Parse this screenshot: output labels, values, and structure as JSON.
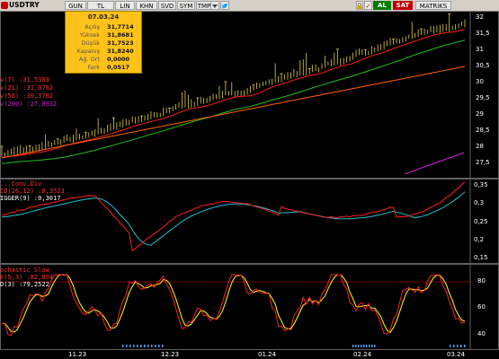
{
  "toolbar": {
    "symbol": "USDTRY",
    "buttons": [
      "GUN",
      "TL",
      "LIN",
      "KHN",
      "SVD",
      "SYM",
      "TMP"
    ],
    "buy_label": "AL",
    "sell_label": "SAT",
    "matrix_label": "MATRiKS"
  },
  "tooltip": {
    "date": "07.03.24",
    "rows": [
      {
        "label": "Açılış",
        "value": "31,7714"
      },
      {
        "label": "Yüksek",
        "value": "31,8681"
      },
      {
        "label": "Düşük",
        "value": "31,7523"
      },
      {
        "label": "Kapanış",
        "value": "31,8240"
      },
      {
        "label": "Ağ. Ort",
        "value": "0,0000"
      },
      {
        "label": "Fark",
        "value": "0,0517"
      }
    ]
  },
  "price_panel": {
    "legend": [
      {
        "text": "v(7)     :31,5303",
        "color": "#ff3030"
      },
      {
        "text": "v(21)    :31,0762",
        "color": "#ff3030"
      },
      {
        "text": "v(56)    :30,3782",
        "color": "#ff3030"
      },
      {
        "text": "v(200)   :27,8932",
        "color": "#d020d0"
      }
    ],
    "y_ticks": [
      "32",
      "31,5",
      "31",
      "30,5",
      "30",
      "29,5",
      "29",
      "28,5",
      "28",
      "27,5"
    ]
  },
  "macd_panel": {
    "legend": [
      {
        "text": "...Conv.Div",
        "color": "#ff3030"
      },
      {
        "text": "CD(26,12)  :0,3523",
        "color": "#ff3030"
      },
      {
        "text": "IGGER(9)   :0,3017",
        "color": "#ffffff"
      }
    ],
    "y_ticks": [
      "0,35",
      "0,3",
      "0,25",
      "0,2",
      "0,15"
    ]
  },
  "stoch_panel": {
    "legend": [
      {
        "text": "ochastic Slow",
        "color": "#ff3030"
      },
      {
        "text": "K(5,3)    :82,894",
        "color": "#ff3030"
      },
      {
        "text": "D(3)      :79,2522",
        "color": "#ffffff"
      }
    ],
    "y_ticks": [
      "80",
      "60",
      "40"
    ]
  },
  "x_ticks": [
    "11.23",
    "12.23",
    "01.24",
    "02.24",
    "03.24"
  ],
  "colors": {
    "candle": "#e0d040",
    "ma7": "#ff2020",
    "ma21": "#20c020",
    "ma56": "#ff6000",
    "ma200": "#d020d0",
    "macd": "#ff2020",
    "signal": "#20c0d0",
    "stoch_k": "#ff2020",
    "stoch_d": "#ffff20"
  }
}
